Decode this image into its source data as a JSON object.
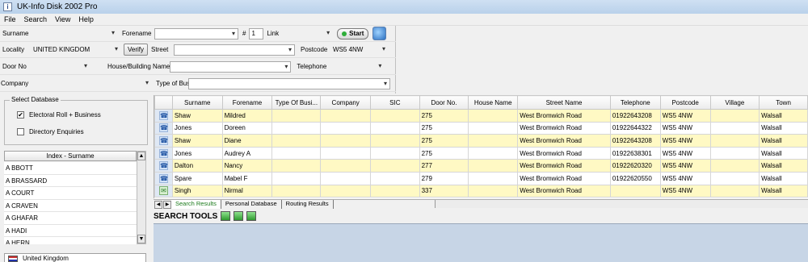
{
  "window": {
    "title": "UK-Info Disk 2002 Pro",
    "icon_glyph": "i"
  },
  "menu": [
    "File",
    "Search",
    "View",
    "Help"
  ],
  "search": {
    "surname_label": "Surname",
    "forename_label": "Forename",
    "hash_label": "#",
    "spin_value": "1",
    "link_label": "Link",
    "start_label": "Start",
    "locality_label": "Locality",
    "locality_value": "UNITED KINGDOM",
    "verify_label": "Verify",
    "street_label": "Street",
    "postcode_label": "Postcode",
    "postcode_value": "WS5 4NW",
    "doorno_label": "Door No",
    "house_label": "House/Building Name",
    "telephone_label": "Telephone",
    "company_label": "Company",
    "typeofbus_label": "Type of Bus."
  },
  "database": {
    "title": "Select Database",
    "options": [
      {
        "label": "Electoral Roll + Business",
        "checked": "✔"
      },
      {
        "label": "Directory Enquiries",
        "checked": ""
      }
    ]
  },
  "index": {
    "header": "Index - Surname",
    "items": [
      "A BBOTT",
      "A BRASSARD",
      "A COURT",
      "A CRAVEN",
      "A GHAFAR",
      "A HADI",
      "A HERN"
    ]
  },
  "country": "United Kingdom",
  "table": {
    "columns": [
      "",
      "Surname",
      "Forename",
      "Type Of Busi...",
      "Company",
      "SIC",
      "Door No.",
      "House Name",
      "Street Name",
      "Telephone",
      "Postcode",
      "Village",
      "Town"
    ],
    "rows": [
      {
        "icon": "phone",
        "cells": [
          "Shaw",
          "Mildred",
          "",
          "",
          "",
          "275",
          "",
          "West Bromwich Road",
          "01922643208",
          "WS5 4NW",
          "",
          "Walsall"
        ]
      },
      {
        "icon": "phone",
        "cells": [
          "Jones",
          "Doreen",
          "",
          "",
          "",
          "275",
          "",
          "West Bromwich Road",
          "01922644322",
          "WS5 4NW",
          "",
          "Walsall"
        ]
      },
      {
        "icon": "phone",
        "cells": [
          "Shaw",
          "Diane",
          "",
          "",
          "",
          "275",
          "",
          "West Bromwich Road",
          "01922643208",
          "WS5 4NW",
          "",
          "Walsall"
        ]
      },
      {
        "icon": "phone",
        "cells": [
          "Jones",
          "Audrey A",
          "",
          "",
          "",
          "275",
          "",
          "West Bromwich Road",
          "01922638301",
          "WS5 4NW",
          "",
          "Walsall"
        ]
      },
      {
        "icon": "phone",
        "cells": [
          "Dalton",
          "Nancy",
          "",
          "",
          "",
          "277",
          "",
          "West Bromwich Road",
          "01922620320",
          "WS5 4NW",
          "",
          "Walsall"
        ]
      },
      {
        "icon": "phone",
        "cells": [
          "Spare",
          "Mabel F",
          "",
          "",
          "",
          "279",
          "",
          "West Bromwich Road",
          "01922620550",
          "WS5 4NW",
          "",
          "Walsall"
        ]
      },
      {
        "icon": "mail",
        "cells": [
          "Singh",
          "Nirmal",
          "",
          "",
          "",
          "337",
          "",
          "West Bromwich Road",
          "",
          "WS5 4NW",
          "",
          "Walsall"
        ]
      }
    ]
  },
  "tabs": [
    "Search Results",
    "Personal Database",
    "Routing Results"
  ],
  "search_tools_label": "SEARCH TOOLS",
  "icons": {
    "phone": "☎",
    "mail": "✉",
    "up": "▲",
    "down": "▼"
  }
}
